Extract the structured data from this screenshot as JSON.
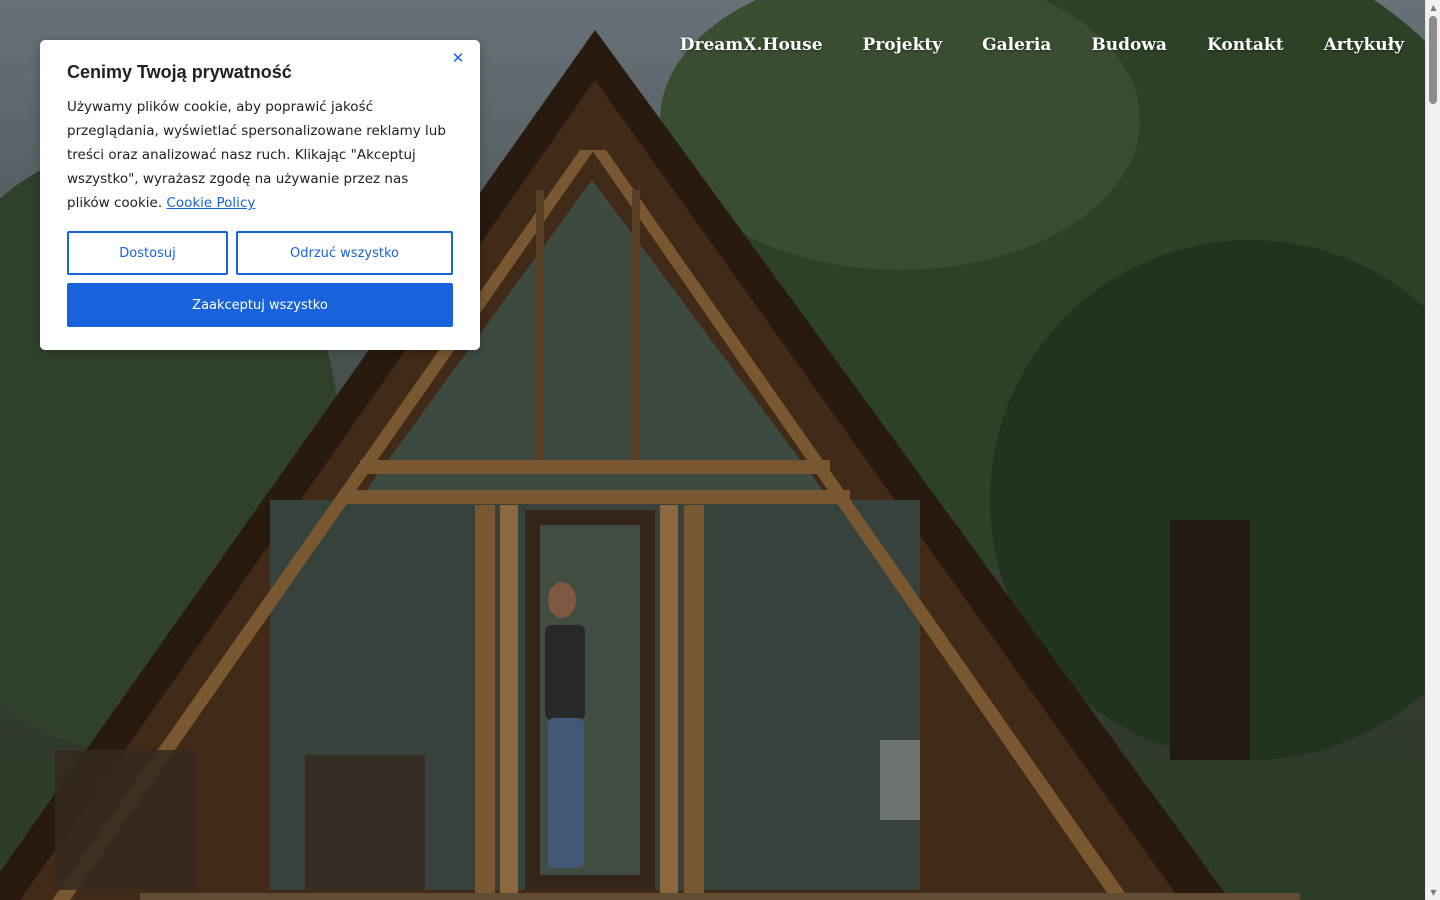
{
  "nav": {
    "items": [
      "DreamX.House",
      "Projekty",
      "Galeria",
      "Budowa",
      "Kontakt",
      "Artykuły"
    ]
  },
  "cookie_banner": {
    "title": "Cenimy Twoją prywatność",
    "body": "Używamy plików cookie, aby poprawić jakość przeglądania, wyświetlać spersonalizowane reklamy lub treści oraz analizować nasz ruch. Klikając \"Akceptuj wszystko\", wyrażasz zgodę na używanie przez nas plików cookie.",
    "policy_link": "Cookie Policy",
    "customize_label": "Dostosuj",
    "reject_label": "Odrzuć wszystko",
    "accept_label": "Zaakceptuj wszystko",
    "close_icon": "close-icon",
    "accent_color": "#1863dc"
  },
  "hero": {
    "image": "a-frame-wooden-house-in-forest"
  }
}
